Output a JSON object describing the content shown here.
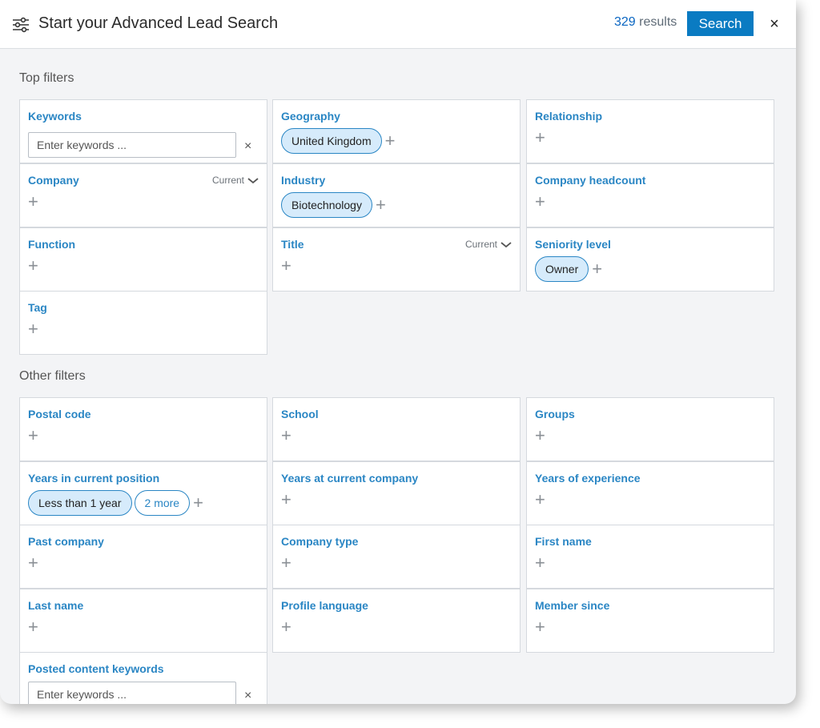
{
  "header": {
    "title": "Start your Advanced Lead Search",
    "results_count": "329",
    "results_label": "results",
    "search_label": "Search",
    "close_label": "×"
  },
  "top_filters": {
    "label": "Top filters",
    "keywords": {
      "title": "Keywords",
      "placeholder": "Enter keywords ...",
      "clear": "×"
    },
    "geography": {
      "title": "Geography",
      "selected": "United Kingdom"
    },
    "relationship": {
      "title": "Relationship"
    },
    "company": {
      "title": "Company",
      "scope": "Current"
    },
    "industry": {
      "title": "Industry",
      "selected": "Biotechnology"
    },
    "company_headcount": {
      "title": "Company headcount"
    },
    "function": {
      "title": "Function"
    },
    "title": {
      "title": "Title",
      "scope": "Current"
    },
    "seniority_level": {
      "title": "Seniority level",
      "selected": "Owner"
    },
    "tag": {
      "title": "Tag"
    }
  },
  "other_filters": {
    "label": "Other filters",
    "postal_code": {
      "title": "Postal code"
    },
    "school": {
      "title": "School"
    },
    "groups": {
      "title": "Groups"
    },
    "years_in_current_position": {
      "title": "Years in current position",
      "selected": "Less than 1 year",
      "more": "2 more"
    },
    "years_at_current_company": {
      "title": "Years at current company"
    },
    "years_of_experience": {
      "title": "Years of experience"
    },
    "past_company": {
      "title": "Past company"
    },
    "company_type": {
      "title": "Company type"
    },
    "first_name": {
      "title": "First name"
    },
    "last_name": {
      "title": "Last name"
    },
    "profile_language": {
      "title": "Profile language"
    },
    "member_since": {
      "title": "Member since"
    },
    "posted_content_keywords": {
      "title": "Posted content keywords",
      "placeholder": "Enter keywords ...",
      "clear": "×"
    }
  },
  "common": {
    "plus": "+"
  },
  "icons": {
    "header": "sliders-icon",
    "add": "plus-icon",
    "clear": "close-icon",
    "scope": "chevron-down-icon"
  },
  "colors": {
    "accent": "#0a7bc2",
    "link": "#2a86c4",
    "pill_bg": "#d6ebfb"
  }
}
